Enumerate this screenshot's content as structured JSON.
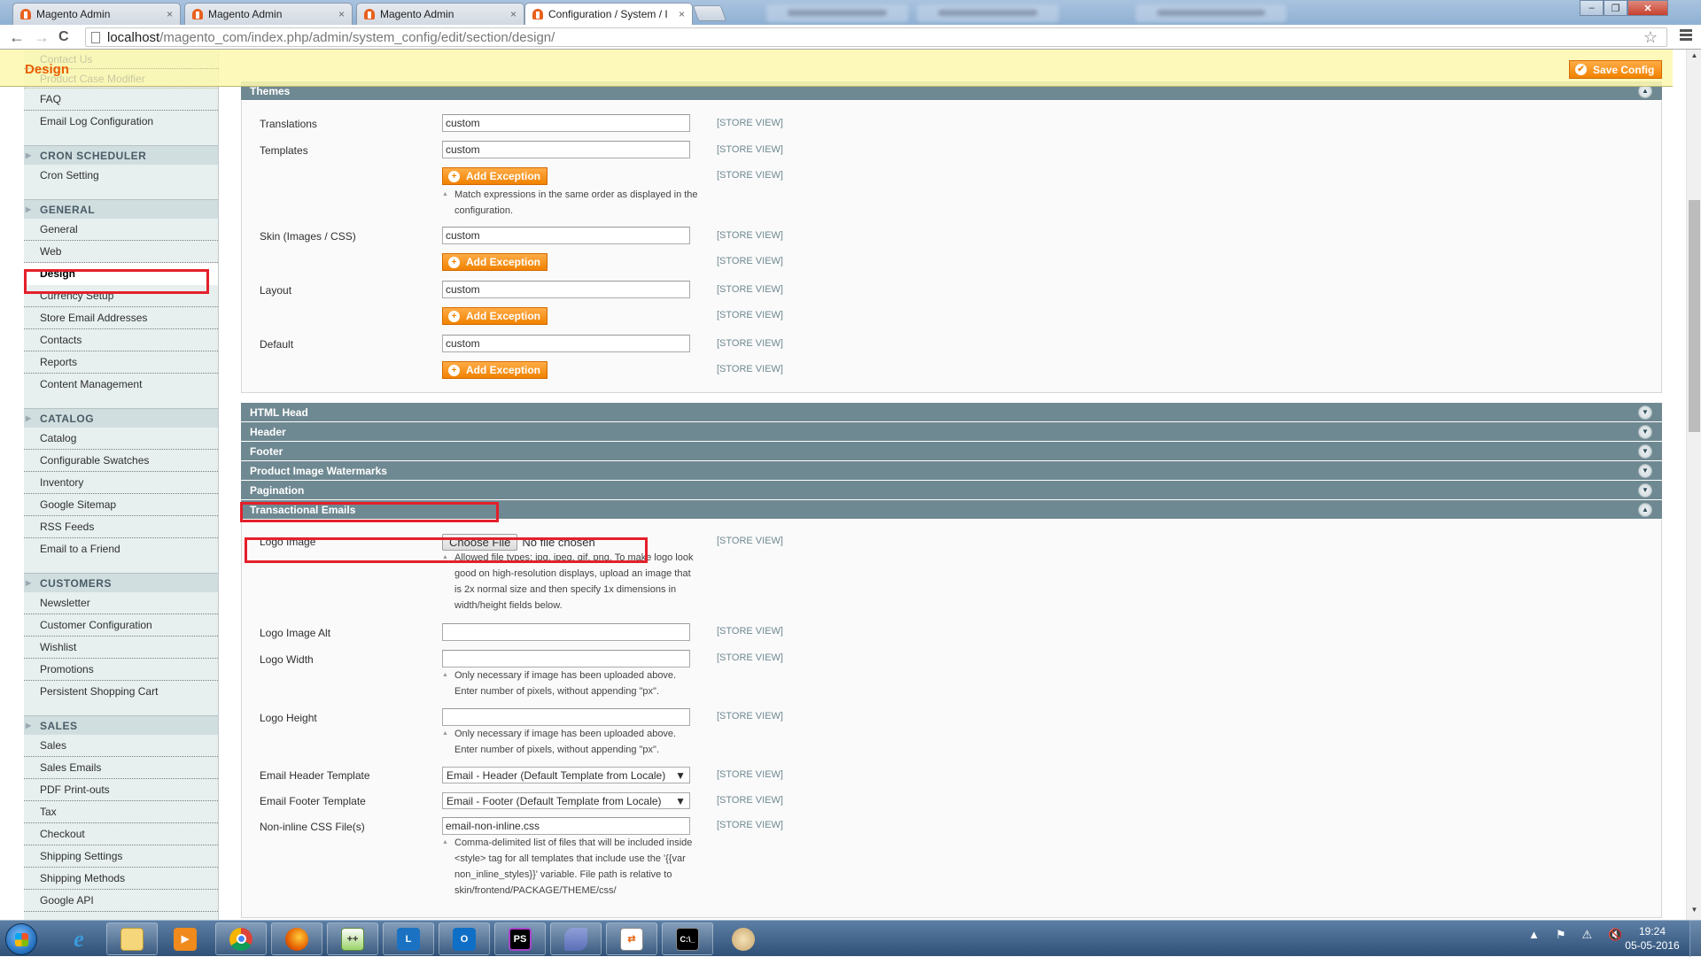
{
  "browser": {
    "tabs": [
      {
        "title": "Magento Admin",
        "active": false
      },
      {
        "title": "Magento Admin",
        "active": false
      },
      {
        "title": "Magento Admin",
        "active": false
      },
      {
        "title": "Configuration / System / I",
        "active": true
      }
    ],
    "tab_close": "×",
    "url_host": "localhost",
    "url_path": "/magento_com/index.php/admin/system_config/edit/section/design/",
    "back_glyph": "←",
    "forward_glyph": "→",
    "reload_glyph": "C",
    "star_glyph": "☆",
    "window": {
      "minimize": "–",
      "restore": "❐",
      "close": "✕"
    }
  },
  "page": {
    "title": "Design",
    "save_button": "Save Config",
    "faded_items": [
      "Contact Us",
      "Product Case Modifier"
    ]
  },
  "sidebar": {
    "top_items": [
      "FAQ",
      "Email Log Configuration"
    ],
    "groups": [
      {
        "heading": "CRON SCHEDULER",
        "items": [
          "Cron Setting"
        ]
      },
      {
        "heading": "GENERAL",
        "items": [
          "General",
          "Web",
          "Design",
          "Currency Setup",
          "Store Email Addresses",
          "Contacts",
          "Reports",
          "Content Management"
        ],
        "active": "Design"
      },
      {
        "heading": "CATALOG",
        "items": [
          "Catalog",
          "Configurable Swatches",
          "Inventory",
          "Google Sitemap",
          "RSS Feeds",
          "Email to a Friend"
        ]
      },
      {
        "heading": "CUSTOMERS",
        "items": [
          "Newsletter",
          "Customer Configuration",
          "Wishlist",
          "Promotions",
          "Persistent Shopping Cart"
        ]
      },
      {
        "heading": "SALES",
        "items": [
          "Sales",
          "Sales Emails",
          "PDF Print-outs",
          "Tax",
          "Checkout",
          "Shipping Settings",
          "Shipping Methods",
          "Google API"
        ]
      }
    ]
  },
  "themes": {
    "heading": "Themes",
    "scope": "[STORE VIEW]",
    "add_exception": "Add Exception",
    "translations": {
      "label": "Translations",
      "value": "custom"
    },
    "templates": {
      "label": "Templates",
      "value": "custom",
      "note": "Match expressions in the same order as displayed in the configuration."
    },
    "skin": {
      "label": "Skin (Images / CSS)",
      "value": "custom"
    },
    "layout": {
      "label": "Layout",
      "value": "custom"
    },
    "default": {
      "label": "Default",
      "value": "custom"
    }
  },
  "collapsed_sections": [
    "HTML Head",
    "Header",
    "Footer",
    "Product Image Watermarks",
    "Pagination"
  ],
  "transactional": {
    "heading": "Transactional Emails",
    "scope": "[STORE VIEW]",
    "logo_image": {
      "label": "Logo Image",
      "button": "Choose File",
      "status": "No file chosen",
      "note": "Allowed file types: jpg, jpeg, gif, png. To make logo look good on high-resolution displays, upload an image that is 2x normal size and then specify 1x dimensions in width/height fields below."
    },
    "logo_alt": {
      "label": "Logo Image Alt",
      "value": ""
    },
    "logo_width": {
      "label": "Logo Width",
      "value": "",
      "note": "Only necessary if image has been uploaded above. Enter number of pixels, without appending \"px\"."
    },
    "logo_height": {
      "label": "Logo Height",
      "value": "",
      "note": "Only necessary if image has been uploaded above. Enter number of pixels, without appending \"px\"."
    },
    "header_template": {
      "label": "Email Header Template",
      "value": "Email - Header (Default Template from Locale)"
    },
    "footer_template": {
      "label": "Email Footer Template",
      "value": "Email - Footer (Default Template from Locale)"
    },
    "non_inline_css": {
      "label": "Non-inline CSS File(s)",
      "value": "email-non-inline.css",
      "note": "Comma-delimited list of files that will be included inside <style> tag for all templates that include use the '{{var non_inline_styles}}' variable. File path is relative to skin/frontend/PACKAGE/THEME/css/"
    }
  },
  "taskbar": {
    "apps": [
      "start",
      "internet-explorer",
      "file-explorer",
      "media-player",
      "chrome",
      "firefox",
      "notepad-plus-plus",
      "lync",
      "outlook",
      "phpstorm",
      "mysql-workbench",
      "file-compare",
      "command-prompt",
      "paint"
    ],
    "time": "19:24",
    "date": "05-05-2016"
  },
  "colors": {
    "accent_orange": "#f18200",
    "section_header": "#6f8992",
    "title_orange": "#eb5e00",
    "highlight_red": "#e4202b"
  }
}
